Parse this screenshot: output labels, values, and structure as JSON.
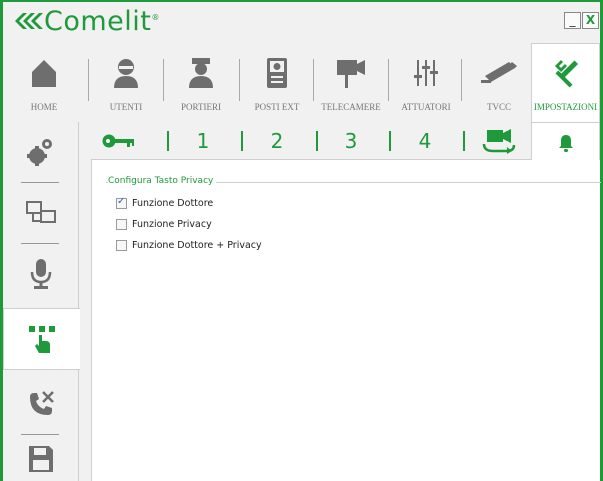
{
  "app": {
    "logo_text": "Comelit",
    "logo_reg": "®",
    "minimize_label": "_",
    "close_label": "X"
  },
  "main_nav": {
    "items": [
      {
        "label": "HOME",
        "icon": "home-icon"
      },
      {
        "label": "UTENTI",
        "icon": "user-icon"
      },
      {
        "label": "PORTIERI",
        "icon": "concierge-icon"
      },
      {
        "label": "POSTI EXT",
        "icon": "entrance-panel-icon"
      },
      {
        "label": "TELECAMERE",
        "icon": "camera-icon"
      },
      {
        "label": "ATTUATORI",
        "icon": "actuator-icon"
      },
      {
        "label": "TVCC",
        "icon": "cctv-icon"
      },
      {
        "label": "IMPOSTAZIONI",
        "icon": "tools-icon"
      }
    ],
    "active": "IMPOSTAZIONI"
  },
  "sidebar": {
    "items": [
      "gears-icon",
      "network-devices-icon",
      "microphone-icon",
      "touch-buttons-icon",
      "call-forward-icon",
      "save-icon"
    ],
    "active": "touch-buttons-icon"
  },
  "sub_tabs": {
    "items": [
      {
        "type": "icon",
        "icon": "key-icon"
      },
      {
        "type": "text",
        "label": "1"
      },
      {
        "type": "text",
        "label": "2"
      },
      {
        "type": "text",
        "label": "3"
      },
      {
        "type": "text",
        "label": "4"
      },
      {
        "type": "icon",
        "icon": "camera-cycle-icon"
      },
      {
        "type": "icon",
        "icon": "bell-icon"
      }
    ],
    "active": "bell-icon"
  },
  "privacy_group": {
    "title": "Configura Tasto Privacy",
    "options": [
      {
        "label": "Funzione Dottore",
        "checked": true
      },
      {
        "label": "Funzione Privacy",
        "checked": false
      },
      {
        "label": "Funzione Dottore + Privacy",
        "checked": false
      }
    ]
  },
  "colors": {
    "accent": "#1f9a3b",
    "icon_gray": "#6e6e6e",
    "panel_bg": "#f1f1f1"
  }
}
